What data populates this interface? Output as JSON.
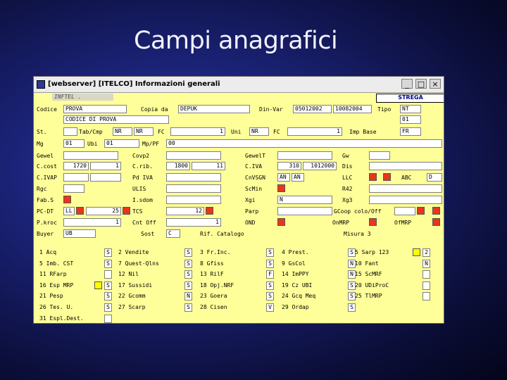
{
  "slide_title": "Campi anagrafici",
  "window": {
    "title": "[webserver] [ITELCO] Informazioni generali",
    "brand_left": "INFTEL .",
    "brand_right": "STREGA",
    "minimize": "_",
    "maximize": "□",
    "close": "×"
  },
  "labels": {
    "codice": "Codice",
    "copia_da": "Copia da",
    "din_var": "Din-Var",
    "tipo": "Tipo",
    "st": "St.",
    "tab_cmp": "Tab/Cmp",
    "fc1": "FC",
    "uni": "Uni",
    "fc2": "FC",
    "imp_base": "Imp Base",
    "mg": "Mg",
    "ubi": "Ubi",
    "mp": "Mp/PF",
    "gewel": "Gewel",
    "covp2": "Covp2",
    "gewel2": "GewelT",
    "gw": "Gw",
    "c_cost": "C.cost",
    "c_rib": "C.rib.",
    "civa": "C.IVA",
    "dis": "Dis",
    "c_ivap": "C.IVAP",
    "pd_iva": "Pd IVA",
    "cnvsgn": "CnVSGN",
    "llc": "LLC",
    "abc": "ABC",
    "rgc": "Rgc",
    "ulis": "ULIS",
    "scmin": "ScMin",
    "r42": "R42",
    "fab_s": "Fab.S",
    "isdom": "I.sdom",
    "xgi": "Xgi",
    "xg3": "Xg3",
    "pcdt": "PC-DT",
    "tcs": "TCS",
    "parp": "Parp",
    "gcop": "GCoop colo/Off",
    "p_kroc": "P.kroc",
    "cnt_off": "Cnt Off",
    "ond": "OND",
    "onmrp": "OnMRP",
    "ofmrp": "OfMRP",
    "buyer": "Buyer",
    "sost": "Sost",
    "rif_catalogo": "Rif. Catalogo",
    "misura3": "Misura 3"
  },
  "values": {
    "codice": "PROVA",
    "copia_da": "DEPUK",
    "din_var_1": "05012002",
    "din_var_2": "10082004",
    "tipo": "NT",
    "tipo2": "01",
    "descrizione": "CODICE DI PROVA",
    "tab1": "NR",
    "tab2": "NR",
    "fc1": "1",
    "uni1": "NR",
    "fc2": "1",
    "imp_base": "FR",
    "mg": "01",
    "ubi": "01",
    "mp": "00",
    "ccost1": "1720",
    "ccost2": "1",
    "crib1": "1800",
    "crib2": "11",
    "civa1": "310",
    "civa2": "1012000",
    "cnvsgn1": "AN",
    "cnvsgn2": "AN",
    "abc": "D",
    "xgi": "N",
    "pcdt1": "LL",
    "pcdt2": "25",
    "tcs": "12",
    "pkroc": "1",
    "cnt_off": "1",
    "buyer": "UB",
    "sost": "C"
  },
  "checks": {
    "c1": [
      "1 Acq",
      "5 Imb. CST",
      "11 RFarp",
      "16 Esp MRP",
      "21 Pesp",
      "26 Tes. U.",
      "31 Espl.Dest."
    ],
    "v1": [
      "S",
      "S",
      "",
      "S",
      "S",
      "S",
      ""
    ],
    "c2": [
      "2 Vendite",
      "7 Quest-Qlns",
      "12 Nil",
      "17 Sussidi",
      "22 Gcomm",
      "27 Scarp"
    ],
    "v2": [
      "S",
      "S",
      "S",
      "S",
      "N",
      "S"
    ],
    "c3": [
      "3 Fr.Inc.",
      "8 Gfiss",
      "13 RilF",
      "18 Opj.NRF",
      "23 Goera",
      "28 Cisen"
    ],
    "v3": [
      "S",
      "S",
      "F",
      "S",
      "S",
      "V"
    ],
    "c4": [
      "4 Prest.",
      "9 GsCol",
      "14 ImPPY",
      "19 Cz UBI",
      "24 Gcq Meq",
      "29 Ordap"
    ],
    "v4": [
      "S",
      "N",
      "N",
      "S",
      "S",
      "S"
    ],
    "c5": [
      "5 Sarp 123",
      "10 Fant",
      "15 ScMRF",
      "20 UDiProC",
      "25 TlMRP"
    ],
    "v5": [
      "2",
      "N",
      "",
      "",
      ""
    ]
  },
  "colors": {
    "panel": "#ffff99",
    "red": "#e8361c",
    "yellow": "#ffff00"
  }
}
